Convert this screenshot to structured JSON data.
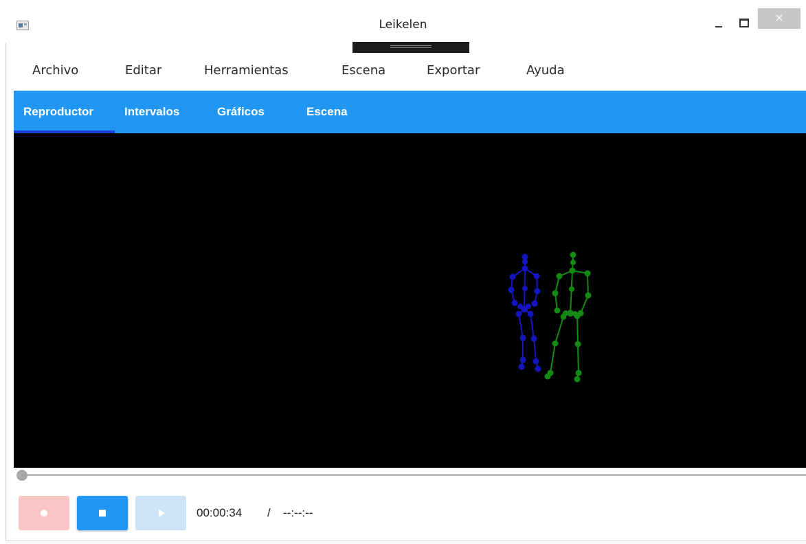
{
  "window": {
    "title": "Leikelen",
    "icon": "app-icon",
    "controls": {
      "minimize": "minimize-icon",
      "maximize": "maximize-icon",
      "close": "×"
    }
  },
  "menu": {
    "items": [
      {
        "label": "Archivo"
      },
      {
        "label": "Editar"
      },
      {
        "label": "Herramientas"
      },
      {
        "label": "Escena"
      },
      {
        "label": "Exportar"
      },
      {
        "label": "Ayuda"
      }
    ]
  },
  "tabs": {
    "items": [
      {
        "label": "Reproductor",
        "active": true
      },
      {
        "label": "Intervalos",
        "active": false
      },
      {
        "label": "Gráficos",
        "active": false
      },
      {
        "label": "Escena",
        "active": false
      }
    ]
  },
  "viewport": {
    "background": "#000000",
    "skeletons": [
      {
        "name": "skeleton-blue",
        "color": "#1515c0"
      },
      {
        "name": "skeleton-green",
        "color": "#138a13"
      }
    ]
  },
  "playback": {
    "progress": 0,
    "record_icon": "record-icon",
    "stop_icon": "stop-icon",
    "play_icon": "play-icon",
    "current_time": "00:00:34",
    "separator": "/",
    "total_time": "--:--:--"
  },
  "colors": {
    "accent": "#2196f3",
    "tab_indicator": "#1a3fe0",
    "record_disabled": "#f9c5c5",
    "play_disabled": "#cde3f8"
  }
}
